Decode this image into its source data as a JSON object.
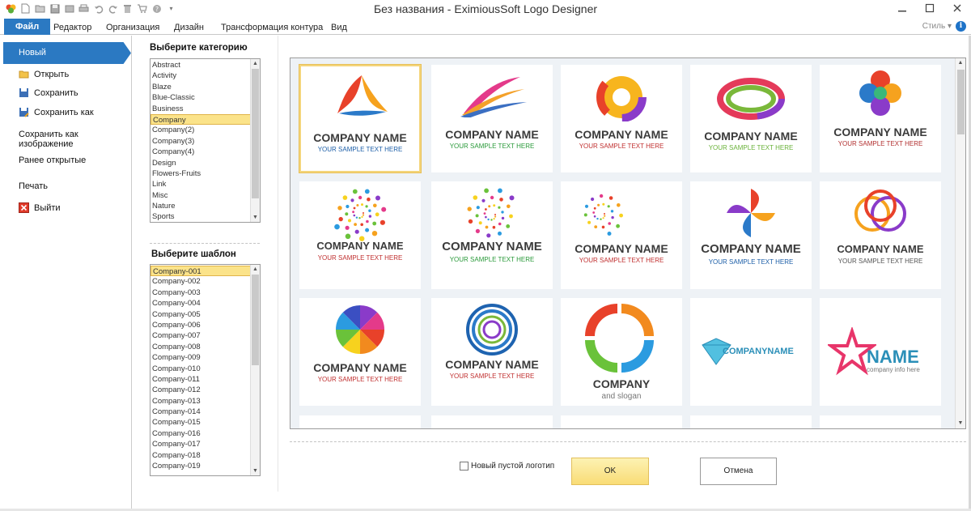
{
  "window": {
    "title": "Без названия - EximiousSoft Logo Designer"
  },
  "quick_access": [
    "app-logo-icon",
    "new-icon",
    "open-icon",
    "save-icon",
    "save-image-icon",
    "print-icon",
    "undo-icon",
    "redo-icon",
    "delete-icon",
    "cart-icon",
    "help-icon"
  ],
  "ribbon": {
    "tabs": [
      "Файл",
      "Редактор",
      "Организация",
      "Дизайн",
      "Трансформация контура",
      "Вид"
    ],
    "style_label": "Стиль",
    "style_arrow": "▾"
  },
  "file_menu": {
    "selected": "Новый",
    "items": [
      {
        "label": "Открыть",
        "icon": "folder-open-icon"
      },
      {
        "label": "Сохранить",
        "icon": "floppy-icon"
      },
      {
        "label": "Сохранить как",
        "icon": "floppy-edit-icon"
      },
      {
        "label": "Сохранить как изображение",
        "icon": ""
      },
      {
        "label": "Ранее открытые",
        "icon": ""
      },
      {
        "label": "Печать",
        "icon": ""
      },
      {
        "label": "Выйти",
        "icon": "exit-icon"
      }
    ]
  },
  "category": {
    "title": "Выберите категорию",
    "items": [
      "Abstract",
      "Activity",
      "Blaze",
      "Blue-Classic",
      "Business",
      "Company",
      "Company(2)",
      "Company(3)",
      "Company(4)",
      "Design",
      "Flowers-Fruits",
      "Link",
      "Misc",
      "Nature",
      "Sports"
    ],
    "selected_index": 5
  },
  "template": {
    "title": "Выберите шаблон",
    "items": [
      "Company-001",
      "Company-002",
      "Company-003",
      "Company-004",
      "Company-005",
      "Company-006",
      "Company-007",
      "Company-008",
      "Company-009",
      "Company-010",
      "Company-011",
      "Company-012",
      "Company-013",
      "Company-014",
      "Company-015",
      "Company-016",
      "Company-017",
      "Company-018",
      "Company-019"
    ],
    "selected_index": 0
  },
  "gallery": {
    "cells": [
      {
        "name": "COMPANY NAME",
        "sub": "YOUR SAMPLE TEXT HERE",
        "subcolor": "#1d5fa8"
      },
      {
        "name": "COMPANY NAME",
        "sub": "YOUR SAMPLE TEXT HERE",
        "subcolor": "#2a9a3a"
      },
      {
        "name": "COMPANY NAME",
        "sub": "YOUR SAMPLE TEXT HERE",
        "subcolor": "#c03030"
      },
      {
        "name": "COMPANY NAME",
        "sub": "YOUR SAMPLE TEXT HERE",
        "subcolor": "#6ab23a"
      },
      {
        "name": "COMPANY NAME",
        "sub": "YOUR SAMPLE TEXT HERE",
        "subcolor": "#b23030"
      },
      {
        "name": "COMPANY NAME",
        "sub": "YOUR SAMPLE TEXT HERE",
        "subcolor": "#c03030"
      },
      {
        "name": "COMPANY NAME",
        "sub": "YOUR SAMPLE TEXT HERE",
        "subcolor": "#2a9a3a"
      },
      {
        "name": "COMPANY NAME",
        "sub": "YOUR SAMPLE TEXT HERE",
        "subcolor": "#c03030"
      },
      {
        "name": "COMPANY NAME",
        "sub": "YOUR SAMPLE TEXT HERE",
        "subcolor": "#1d5fa8"
      },
      {
        "name": "COMPANY NAME",
        "sub": "YOUR SAMPLE TEXT HERE",
        "subcolor": "#555555"
      },
      {
        "name": "COMPANY NAME",
        "sub": "YOUR SAMPLE TEXT HERE",
        "subcolor": "#c03030"
      },
      {
        "name": "COMPANY NAME",
        "sub": "YOUR SAMPLE TEXT HERE",
        "subcolor": "#c03030"
      },
      {
        "name": "COMPANY",
        "sub": "and slogan",
        "subcolor": "#777777"
      },
      {
        "name": "COMPANYNAME",
        "sub": "",
        "subcolor": "#777777"
      },
      {
        "name": "NAME",
        "sub": "company info here",
        "subcolor": "#777777"
      }
    ],
    "selected_index": 0
  },
  "bottom": {
    "checkbox_label": "Новый пустой логотип",
    "ok_label": "OK",
    "cancel_label": "Отмена"
  },
  "colors": {
    "accent": "#2b79c2",
    "selection": "#fbe38a"
  }
}
